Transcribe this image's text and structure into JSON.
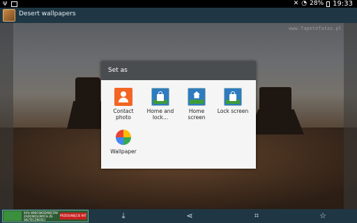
{
  "status_bar": {
    "time": "19:33",
    "battery": "28%"
  },
  "app_bar": {
    "title": "Desert wallpapers"
  },
  "background": {
    "watermark": "www.TapeteTatas.pl"
  },
  "dialog": {
    "title": "Set as",
    "options": [
      {
        "label": "Contact photo",
        "icon": "contact-icon"
      },
      {
        "label": "Home and lock...",
        "icon": "home-lock-screen-icon"
      },
      {
        "label": "Home screen",
        "icon": "home-screen-icon"
      },
      {
        "label": "Lock screen",
        "icon": "lock-screen-icon"
      },
      {
        "label": "Wallpaper",
        "icon": "wallpaper-pinwheel-icon"
      }
    ]
  },
  "bottom_bar": {
    "ad": {
      "text": "94% WNIOSKODAWCÓW ZADOWOLONYCH ZE SKUTECZNOŚCI",
      "button": "PRZESUNIĘCIE RAT"
    },
    "icons": [
      "download-icon",
      "share-icon",
      "crop-icon",
      "star-icon"
    ]
  }
}
